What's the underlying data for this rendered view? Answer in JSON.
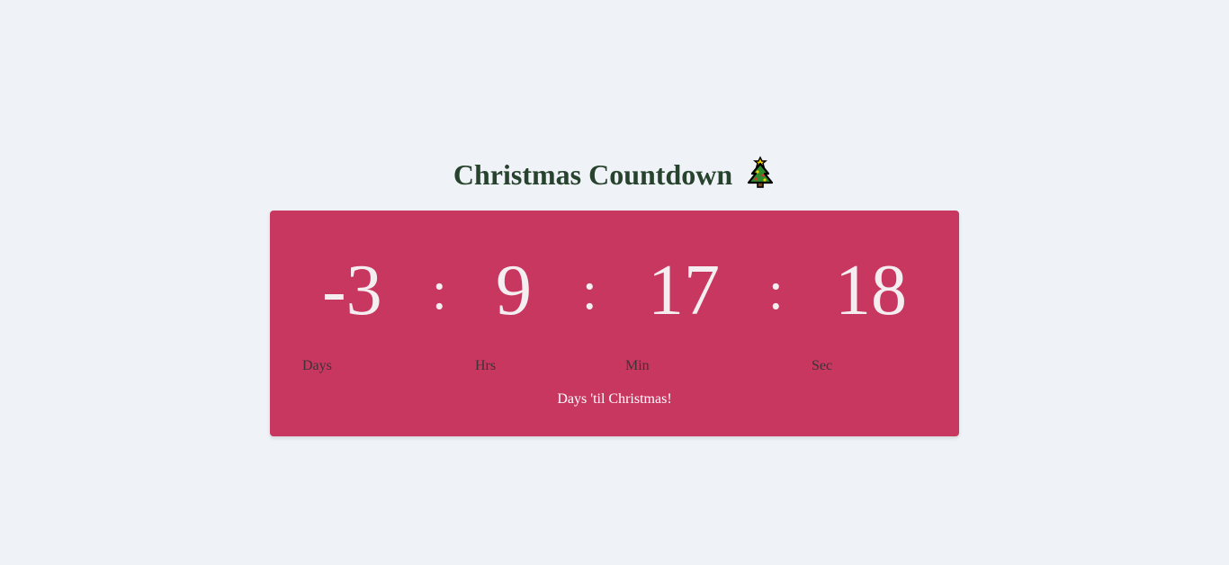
{
  "header": {
    "title": "Christmas Countdown",
    "icon": "christmas-tree-icon"
  },
  "countdown": {
    "days": "-3",
    "hours": "9",
    "minutes": "17",
    "seconds": "18",
    "separator": ":",
    "labels": {
      "days": "Days",
      "hours": "Hrs",
      "minutes": "Min",
      "seconds": "Sec"
    },
    "caption": "Days 'til Christmas!"
  },
  "colors": {
    "background": "#eff3f7",
    "card": "#c83760",
    "title": "#27432e",
    "digits": "#f4eef1",
    "labels": "#3f3236",
    "caption": "#ffffff"
  }
}
